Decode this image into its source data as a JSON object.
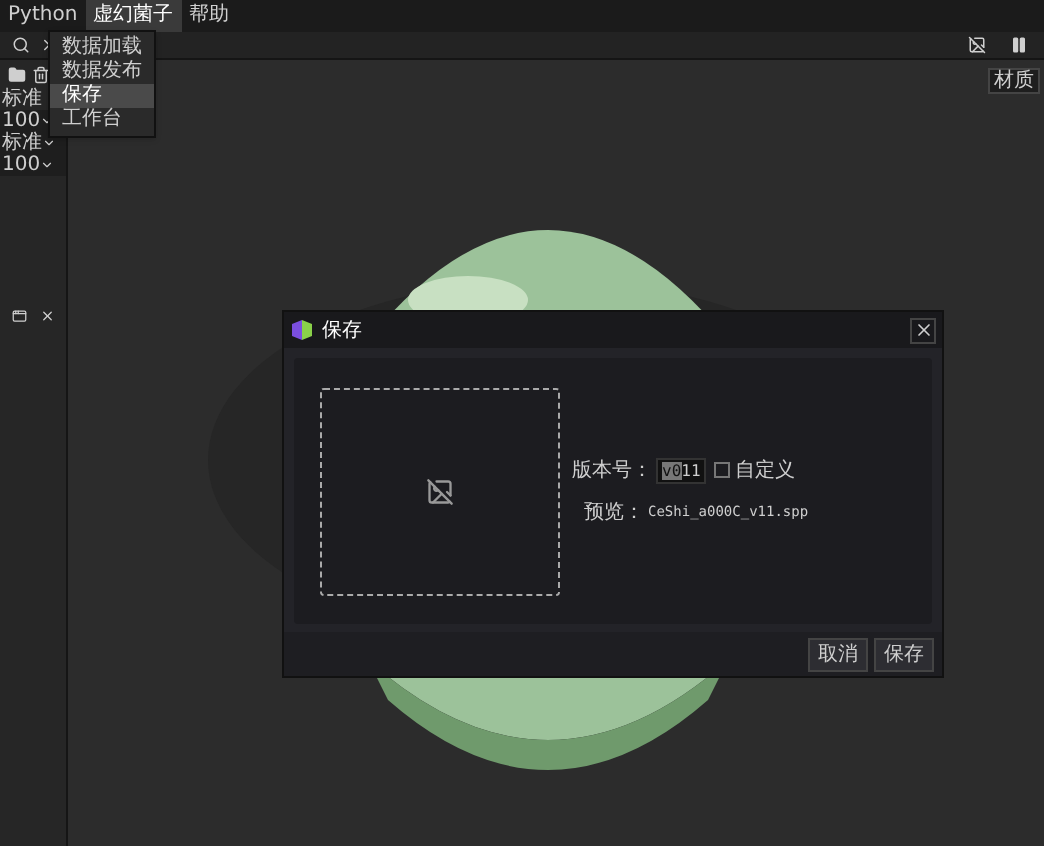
{
  "menubar": [
    {
      "label": "Python",
      "selected": false
    },
    {
      "label": "虚幻菌子",
      "selected": true
    },
    {
      "label": "帮助",
      "selected": false
    }
  ],
  "dropdown": [
    {
      "label": "数据加载",
      "selected": false
    },
    {
      "label": "数据发布",
      "selected": false
    },
    {
      "label": "保存",
      "selected": true
    },
    {
      "label": "工作台",
      "selected": false
    }
  ],
  "left_panel": [
    {
      "label": "标准"
    },
    {
      "label": "100",
      "kind": "select"
    },
    {
      "label": "标准",
      "kind": "select"
    },
    {
      "label": "100",
      "kind": "select"
    }
  ],
  "viewport": {
    "button": "材质"
  },
  "dialog": {
    "title": "保存",
    "version_label": "版本号：",
    "version_selected": "v0",
    "version_value": "11",
    "custom": {
      "label": "自定义",
      "checked": false
    },
    "preview_label": "预览：",
    "preview_value": "CeShi_a000C_v11.spp",
    "buttons": [
      "取消",
      "保存"
    ]
  }
}
